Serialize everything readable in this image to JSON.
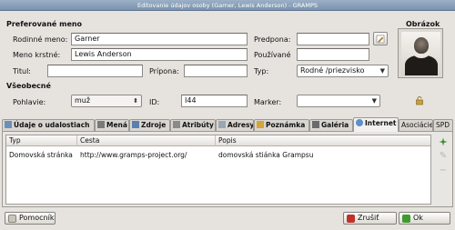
{
  "window": {
    "title": "Editovanie údajov osoby (Garner, Lewis Anderson) - GRAMPS"
  },
  "sections": {
    "preferred_name": "Preferované meno",
    "general": "Všeobecné",
    "image": "Obrázok"
  },
  "fields": {
    "surname": {
      "label": "Rodinné meno:",
      "value": "Garner"
    },
    "prefix": {
      "label": "Predpona:",
      "value": ""
    },
    "given": {
      "label": "Meno krstné:",
      "value": "Lewis Anderson"
    },
    "call": {
      "label": "Používané",
      "value": ""
    },
    "title": {
      "label": "Titul:",
      "value": ""
    },
    "suffix": {
      "label": "Prípona:",
      "value": ""
    },
    "type": {
      "label": "Typ:",
      "value": "Rodné /priezvisko"
    },
    "gender": {
      "label": "Pohlavie:",
      "value": "muž"
    },
    "id": {
      "label": "ID:",
      "value": "I44"
    },
    "marker": {
      "label": "Marker:",
      "value": ""
    }
  },
  "tabs": [
    {
      "label": "Údaje o udalostiach",
      "icon": "events-icon"
    },
    {
      "label": "Mená",
      "icon": "names-icon"
    },
    {
      "label": "Zdroje",
      "icon": "sources-icon"
    },
    {
      "label": "Atribúty",
      "icon": "attributes-icon"
    },
    {
      "label": "Adresy",
      "icon": "addresses-icon"
    },
    {
      "label": "Poznámka",
      "icon": "note-icon"
    },
    {
      "label": "Galéria",
      "icon": "gallery-icon"
    },
    {
      "label": "Internet",
      "icon": "internet-icon"
    },
    {
      "label": "Asociácie",
      "icon": ""
    },
    {
      "label": "SPD",
      "icon": ""
    }
  ],
  "active_tab": "Internet",
  "table": {
    "columns": [
      "Typ",
      "Cesta",
      "Popis"
    ],
    "rows": [
      [
        "Domovská stránka",
        "http://www.gramps-project.org/",
        "domovská stiánka Grampsu"
      ]
    ]
  },
  "buttons": {
    "help": "Pomocník",
    "cancel": "Zrušiť",
    "ok": "Ok"
  },
  "colors": {
    "accent_add": "#3d8f2b",
    "cancel_red": "#c0312b",
    "ok_green": "#3f9a2f"
  }
}
